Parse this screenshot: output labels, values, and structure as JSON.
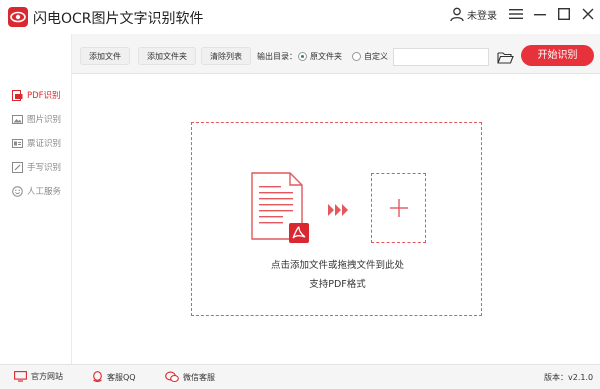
{
  "app": {
    "title": "闪电OCR图片文字识别软件",
    "user_label": "未登录",
    "accent_color": "#e8323b"
  },
  "window_controls": {
    "menu_icon": "hamburger-icon",
    "minimize_icon": "minimize-icon",
    "maximize_icon": "maximize-icon",
    "close_icon": "close-icon"
  },
  "toolbar": {
    "add_file": "添加文件",
    "add_folder": "添加文件夹",
    "clear_list": "清除列表",
    "output_label": "输出目录：",
    "option_source": "原文件夹",
    "option_custom": "自定义",
    "selected_option": "原文件夹",
    "path_value": "",
    "start_button": "开始识别"
  },
  "sidebar": {
    "items": [
      {
        "label": "PDF识别",
        "icon": "pdf-icon",
        "active": true
      },
      {
        "label": "图片识别",
        "icon": "image-icon",
        "active": false
      },
      {
        "label": "票证识别",
        "icon": "id-card-icon",
        "active": false
      },
      {
        "label": "手写识别",
        "icon": "pen-icon",
        "active": false
      },
      {
        "label": "人工服务",
        "icon": "smile-icon",
        "active": false
      }
    ]
  },
  "dropzone": {
    "hint_line1": "点击添加文件或拖拽文件到此处",
    "hint_line2": "支持PDF格式",
    "add_icon": "plus-icon"
  },
  "footer": {
    "website": "官方网站",
    "qq": "客服QQ",
    "wechat": "微信客服",
    "version": "版本：v2.1.0"
  }
}
